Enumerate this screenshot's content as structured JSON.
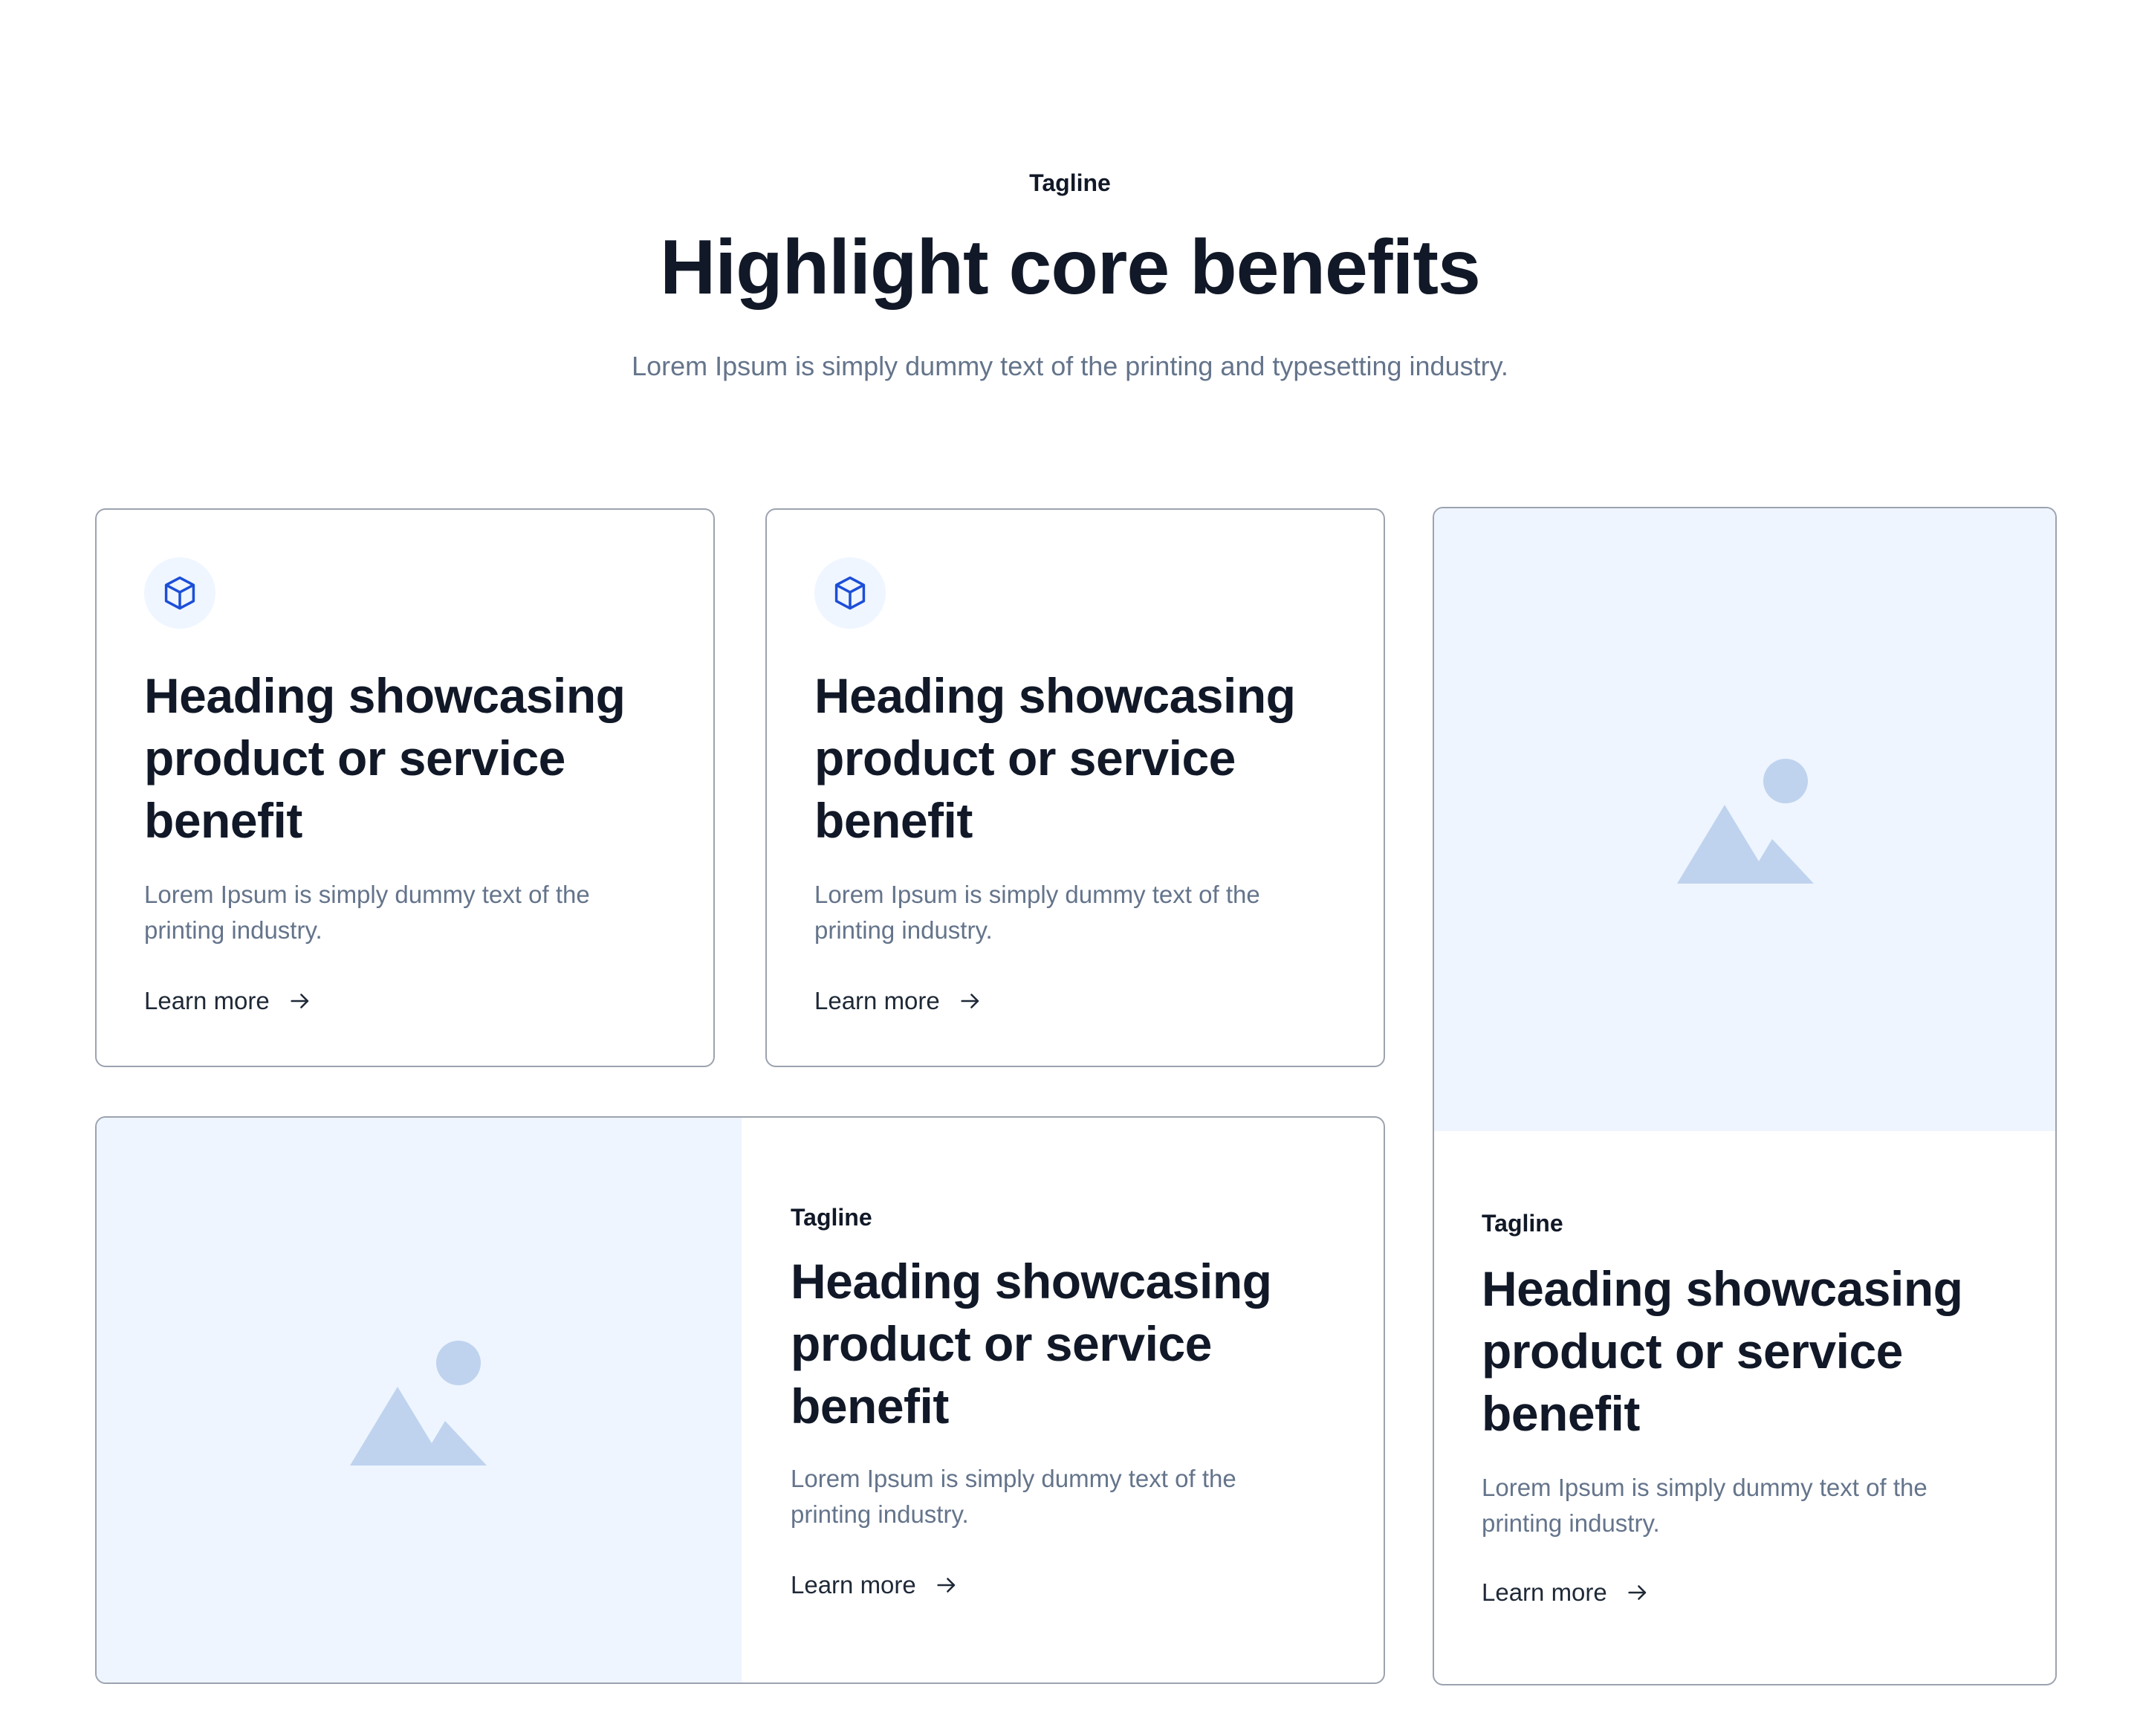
{
  "header": {
    "tagline": "Tagline",
    "title": "Highlight core benefits",
    "subtitle": "Lorem Ipsum is simply dummy text of the printing and typesetting industry."
  },
  "cards": [
    {
      "icon": "cube-icon",
      "heading": "Heading showcasing product or service benefit",
      "description": "Lorem Ipsum is simply dummy text of the printing industry.",
      "link": "Learn more"
    },
    {
      "icon": "cube-icon",
      "heading": "Heading showcasing product or service benefit",
      "description": "Lorem Ipsum is simply dummy text of the printing industry.",
      "link": "Learn more"
    },
    {
      "image": "image-placeholder-icon",
      "tagline": "Tagline",
      "heading": "Heading showcasing product or service benefit",
      "description": "Lorem Ipsum is simply dummy text of the printing industry.",
      "link": "Learn more"
    },
    {
      "image": "image-placeholder-icon",
      "tagline": "Tagline",
      "heading": "Heading showcasing product or service benefit",
      "description": "Lorem Ipsum is simply dummy text of the printing industry.",
      "link": "Learn more"
    }
  ],
  "colors": {
    "text": "#111827",
    "muted": "#64748b",
    "accent": "#1d4ed8",
    "image_bg": "#eef5ff",
    "image_fg": "#bfd3ee",
    "border": "#9ca3af"
  }
}
